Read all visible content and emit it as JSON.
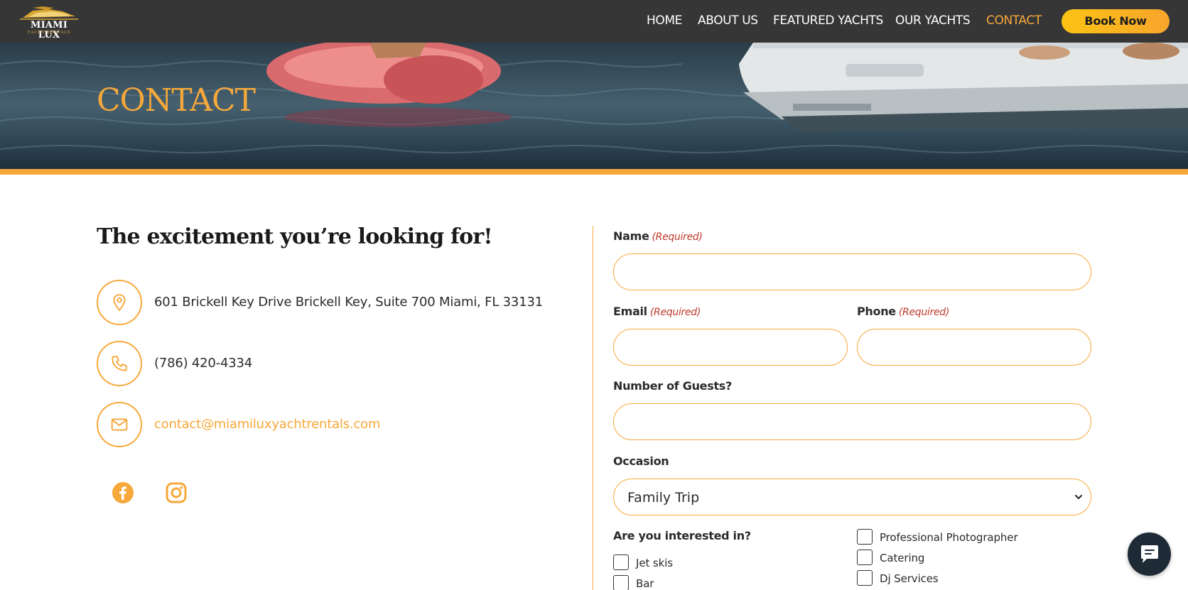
{
  "header": {
    "logo_main": "MIAMI LUX",
    "logo_sub": "YACHT RENTALS",
    "nav": [
      {
        "label": "HOME"
      },
      {
        "label": "ABOUT US"
      },
      {
        "label": "FEATURED YACHTS"
      },
      {
        "label": "OUR YACHTS"
      },
      {
        "label": "CONTACT",
        "active": true
      }
    ],
    "cta_label": "Book Now"
  },
  "hero": {
    "title": "CONTACT"
  },
  "contact_info": {
    "heading": "The excitement you’re looking for!",
    "address": "601 Brickell Key Drive Brickell Key, Suite 700 Miami, FL 33131",
    "phone": "(786) 420-4334",
    "email": "contact@miamiluxyachtrentals.com",
    "icons": {
      "address": "map-pin-icon",
      "phone": "phone-icon",
      "email": "envelope-icon"
    },
    "social": [
      "facebook-icon",
      "instagram-icon"
    ]
  },
  "form": {
    "required_text": "(Required)",
    "name_label": "Name",
    "email_label": "Email",
    "phone_label": "Phone",
    "guests_label": "Number of Guests?",
    "occasion_label": "Occasion",
    "occasion_value": "Family Trip",
    "interests_label": "Are you interested in?",
    "interests_left": [
      "Jet skis",
      "Bar"
    ],
    "interests_right": [
      "Professional Photographer",
      "Catering",
      "Dj Services"
    ]
  },
  "colors": {
    "accent": "#f7a83b",
    "header_bg": "#363636",
    "cta_start": "#fbc314",
    "cta_end": "#f7a52c",
    "required": "#c0392b",
    "chat_bg": "#1e2a36"
  }
}
